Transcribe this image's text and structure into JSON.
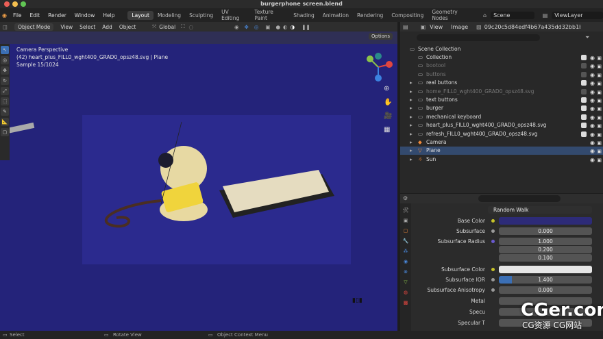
{
  "window": {
    "title": "burgerphone screen.blend"
  },
  "menu": [
    "File",
    "Edit",
    "Render",
    "Window",
    "Help"
  ],
  "workspaces": [
    "Layout",
    "Modeling",
    "Sculpting",
    "UV Editing",
    "Texture Paint",
    "Shading",
    "Animation",
    "Rendering",
    "Compositing",
    "Geometry Nodes",
    "Scripting"
  ],
  "scene": {
    "label": "Scene",
    "viewlayer": "ViewLayer"
  },
  "viewport_header": {
    "mode": "Object Mode",
    "view": "View",
    "select": "Select",
    "add": "Add",
    "object": "Object",
    "transform": "Global",
    "options": "Options"
  },
  "viewport": {
    "perspective": "Camera Perspective",
    "object_line": "(42) heart_plus_FILL0_wght400_GRAD0_opsz48.svg | Plane",
    "sample": "Sample 15/1024"
  },
  "outliner_header": {
    "view": "View",
    "image": "Image",
    "hash": "09c20c5d84edf4b67a435dd32bb1b195..."
  },
  "outliner": {
    "root": "Scene Collection",
    "items": [
      {
        "label": "Collection",
        "checked": true,
        "dim": false
      },
      {
        "label": "bootool",
        "checked": false,
        "dim": true
      },
      {
        "label": "buttons",
        "checked": false,
        "dim": true
      },
      {
        "label": "real buttons",
        "checked": true,
        "dim": false
      },
      {
        "label": "home_FILL0_wght400_GRAD0_opsz48.svg",
        "checked": false,
        "dim": true
      },
      {
        "label": "text buttons",
        "checked": true,
        "dim": false
      },
      {
        "label": "burger",
        "checked": true,
        "dim": false
      },
      {
        "label": "mechanical keyboard",
        "checked": true,
        "dim": false
      },
      {
        "label": "heart_plus_FILL0_wght400_GRAD0_opsz48.svg",
        "checked": true,
        "dim": false
      },
      {
        "label": "refresh_FILL0_wght400_GRAD0_opsz48.svg",
        "checked": true,
        "dim": false
      },
      {
        "label": "Camera",
        "checked": false,
        "dim": false
      },
      {
        "label": "Plane",
        "checked": false,
        "dim": false,
        "selected": true
      },
      {
        "label": "Sun",
        "checked": false,
        "dim": false
      }
    ]
  },
  "properties": {
    "method": "Random Walk",
    "base_color_label": "Base Color",
    "subsurface_label": "Subsurface",
    "subsurface": "0.000",
    "radius_label": "Subsurface Radius",
    "radius": [
      "1.000",
      "0.200",
      "0.100"
    ],
    "ss_color_label": "Subsurface Color",
    "ior_label": "Subsurface IOR",
    "ior": "1.400",
    "aniso_label": "Subsurface Anisotropy",
    "aniso": "0.000",
    "metal_label": "Metal",
    "spec_label": "Specu",
    "spec_tint_label": "Specular T"
  },
  "status": {
    "select": "Select",
    "rotate": "Rotate View",
    "context": "Object Context Menu"
  },
  "watermark": {
    "big": "CGer.com",
    "small": "CG资源 CG网站"
  }
}
